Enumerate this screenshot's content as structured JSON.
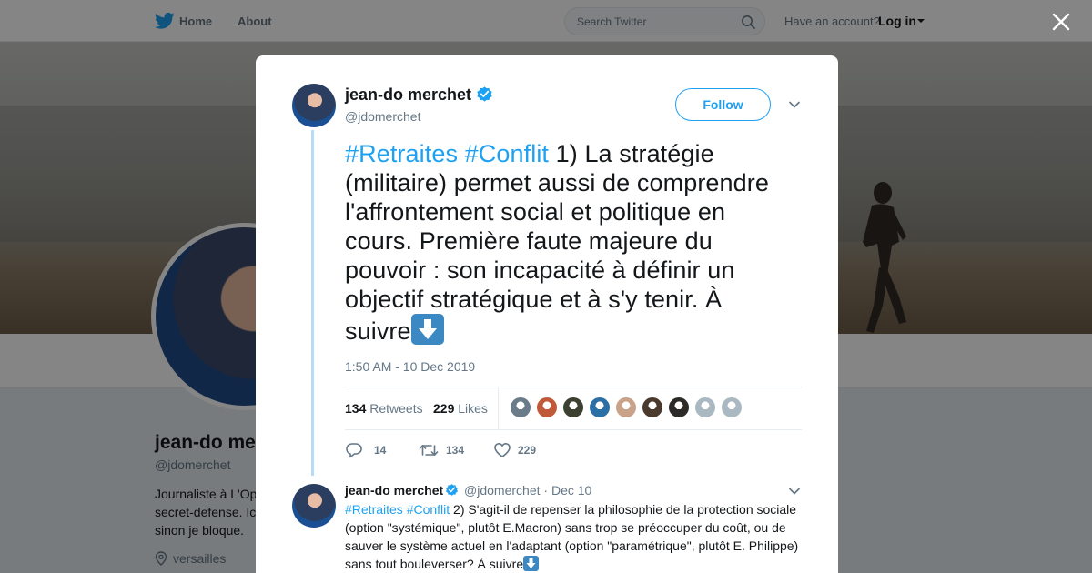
{
  "topnav": {
    "home_label": "Home",
    "about_label": "About",
    "search_placeholder": "Search Twitter",
    "have_account": "Have an account?",
    "login_label": "Log in"
  },
  "profile": {
    "name": "jean-do me",
    "handle": "@jdomerchet",
    "bio": "Journaliste à L'Op secret-defense. Ic sinon je bloque.",
    "location": "versailles"
  },
  "tweet": {
    "author_name": "jean-do merchet",
    "author_handle": "@jdomerchet",
    "follow_label": "Follow",
    "hashtag1": "#Retraites",
    "hashtag2": "#Conflit",
    "body": " 1) La stratégie (militaire) permet aussi de comprendre l'affrontement social et politique en cours. Première faute majeure du pouvoir : son incapacité à définir un objectif stratégique et à s'y tenir.  À suivre",
    "timestamp": "1:50 AM - 10 Dec 2019",
    "retweets_count": "134",
    "retweets_label": "Retweets",
    "likes_count": "229",
    "likes_label": "Likes",
    "actions": {
      "replies": "14",
      "retweets": "134",
      "likes": "229"
    }
  },
  "reply": {
    "author_name": "jean-do merchet",
    "author_handle": "@jdomerchet",
    "separator": "·",
    "date": "Dec 10",
    "hashtag1": "#Retraites",
    "hashtag2": "#Conflit",
    "body": " 2) S'agit-il de repenser la philosophie de la protection sociale (option \"systémique\", plutôt E.Macron) sans trop se préoccuper du coût, ou de sauver le système actuel en l'adaptant (option \"paramétrique\", plutôt E. Philippe) sans tout bouleverser? À suivre"
  },
  "colors": {
    "accent": "#1da1f2",
    "text": "#14171a",
    "muted": "#657786",
    "thread_line": "#b8dcf5"
  },
  "likers": [
    "#6a7c8a",
    "#c0583a",
    "#3b4030",
    "#2b6fa5",
    "#c9a28a",
    "#4a3a2e",
    "#2c2a26",
    "#aab8c2",
    "#aab8c2"
  ]
}
